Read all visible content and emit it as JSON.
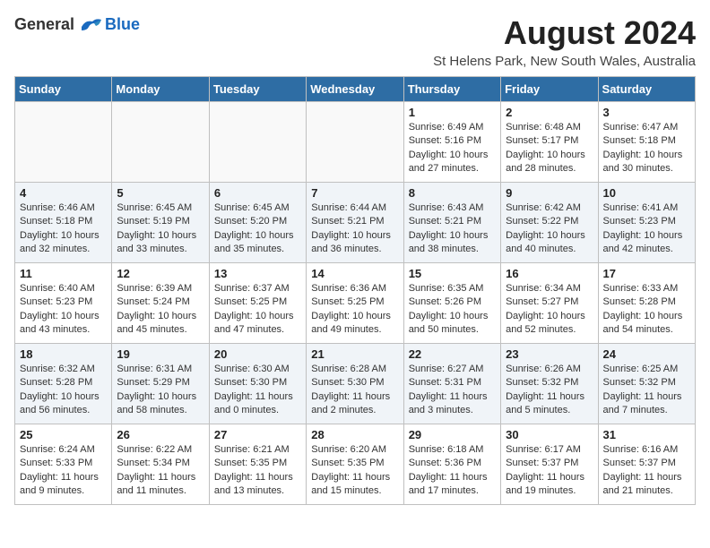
{
  "header": {
    "logo_general": "General",
    "logo_blue": "Blue",
    "month_title": "August 2024",
    "location": "St Helens Park, New South Wales, Australia"
  },
  "days_of_week": [
    "Sunday",
    "Monday",
    "Tuesday",
    "Wednesday",
    "Thursday",
    "Friday",
    "Saturday"
  ],
  "weeks": [
    [
      {
        "day": "",
        "info": ""
      },
      {
        "day": "",
        "info": ""
      },
      {
        "day": "",
        "info": ""
      },
      {
        "day": "",
        "info": ""
      },
      {
        "day": "1",
        "info": "Sunrise: 6:49 AM\nSunset: 5:16 PM\nDaylight: 10 hours\nand 27 minutes."
      },
      {
        "day": "2",
        "info": "Sunrise: 6:48 AM\nSunset: 5:17 PM\nDaylight: 10 hours\nand 28 minutes."
      },
      {
        "day": "3",
        "info": "Sunrise: 6:47 AM\nSunset: 5:18 PM\nDaylight: 10 hours\nand 30 minutes."
      }
    ],
    [
      {
        "day": "4",
        "info": "Sunrise: 6:46 AM\nSunset: 5:18 PM\nDaylight: 10 hours\nand 32 minutes."
      },
      {
        "day": "5",
        "info": "Sunrise: 6:45 AM\nSunset: 5:19 PM\nDaylight: 10 hours\nand 33 minutes."
      },
      {
        "day": "6",
        "info": "Sunrise: 6:45 AM\nSunset: 5:20 PM\nDaylight: 10 hours\nand 35 minutes."
      },
      {
        "day": "7",
        "info": "Sunrise: 6:44 AM\nSunset: 5:21 PM\nDaylight: 10 hours\nand 36 minutes."
      },
      {
        "day": "8",
        "info": "Sunrise: 6:43 AM\nSunset: 5:21 PM\nDaylight: 10 hours\nand 38 minutes."
      },
      {
        "day": "9",
        "info": "Sunrise: 6:42 AM\nSunset: 5:22 PM\nDaylight: 10 hours\nand 40 minutes."
      },
      {
        "day": "10",
        "info": "Sunrise: 6:41 AM\nSunset: 5:23 PM\nDaylight: 10 hours\nand 42 minutes."
      }
    ],
    [
      {
        "day": "11",
        "info": "Sunrise: 6:40 AM\nSunset: 5:23 PM\nDaylight: 10 hours\nand 43 minutes."
      },
      {
        "day": "12",
        "info": "Sunrise: 6:39 AM\nSunset: 5:24 PM\nDaylight: 10 hours\nand 45 minutes."
      },
      {
        "day": "13",
        "info": "Sunrise: 6:37 AM\nSunset: 5:25 PM\nDaylight: 10 hours\nand 47 minutes."
      },
      {
        "day": "14",
        "info": "Sunrise: 6:36 AM\nSunset: 5:25 PM\nDaylight: 10 hours\nand 49 minutes."
      },
      {
        "day": "15",
        "info": "Sunrise: 6:35 AM\nSunset: 5:26 PM\nDaylight: 10 hours\nand 50 minutes."
      },
      {
        "day": "16",
        "info": "Sunrise: 6:34 AM\nSunset: 5:27 PM\nDaylight: 10 hours\nand 52 minutes."
      },
      {
        "day": "17",
        "info": "Sunrise: 6:33 AM\nSunset: 5:28 PM\nDaylight: 10 hours\nand 54 minutes."
      }
    ],
    [
      {
        "day": "18",
        "info": "Sunrise: 6:32 AM\nSunset: 5:28 PM\nDaylight: 10 hours\nand 56 minutes."
      },
      {
        "day": "19",
        "info": "Sunrise: 6:31 AM\nSunset: 5:29 PM\nDaylight: 10 hours\nand 58 minutes."
      },
      {
        "day": "20",
        "info": "Sunrise: 6:30 AM\nSunset: 5:30 PM\nDaylight: 11 hours\nand 0 minutes."
      },
      {
        "day": "21",
        "info": "Sunrise: 6:28 AM\nSunset: 5:30 PM\nDaylight: 11 hours\nand 2 minutes."
      },
      {
        "day": "22",
        "info": "Sunrise: 6:27 AM\nSunset: 5:31 PM\nDaylight: 11 hours\nand 3 minutes."
      },
      {
        "day": "23",
        "info": "Sunrise: 6:26 AM\nSunset: 5:32 PM\nDaylight: 11 hours\nand 5 minutes."
      },
      {
        "day": "24",
        "info": "Sunrise: 6:25 AM\nSunset: 5:32 PM\nDaylight: 11 hours\nand 7 minutes."
      }
    ],
    [
      {
        "day": "25",
        "info": "Sunrise: 6:24 AM\nSunset: 5:33 PM\nDaylight: 11 hours\nand 9 minutes."
      },
      {
        "day": "26",
        "info": "Sunrise: 6:22 AM\nSunset: 5:34 PM\nDaylight: 11 hours\nand 11 minutes."
      },
      {
        "day": "27",
        "info": "Sunrise: 6:21 AM\nSunset: 5:35 PM\nDaylight: 11 hours\nand 13 minutes."
      },
      {
        "day": "28",
        "info": "Sunrise: 6:20 AM\nSunset: 5:35 PM\nDaylight: 11 hours\nand 15 minutes."
      },
      {
        "day": "29",
        "info": "Sunrise: 6:18 AM\nSunset: 5:36 PM\nDaylight: 11 hours\nand 17 minutes."
      },
      {
        "day": "30",
        "info": "Sunrise: 6:17 AM\nSunset: 5:37 PM\nDaylight: 11 hours\nand 19 minutes."
      },
      {
        "day": "31",
        "info": "Sunrise: 6:16 AM\nSunset: 5:37 PM\nDaylight: 11 hours\nand 21 minutes."
      }
    ]
  ]
}
